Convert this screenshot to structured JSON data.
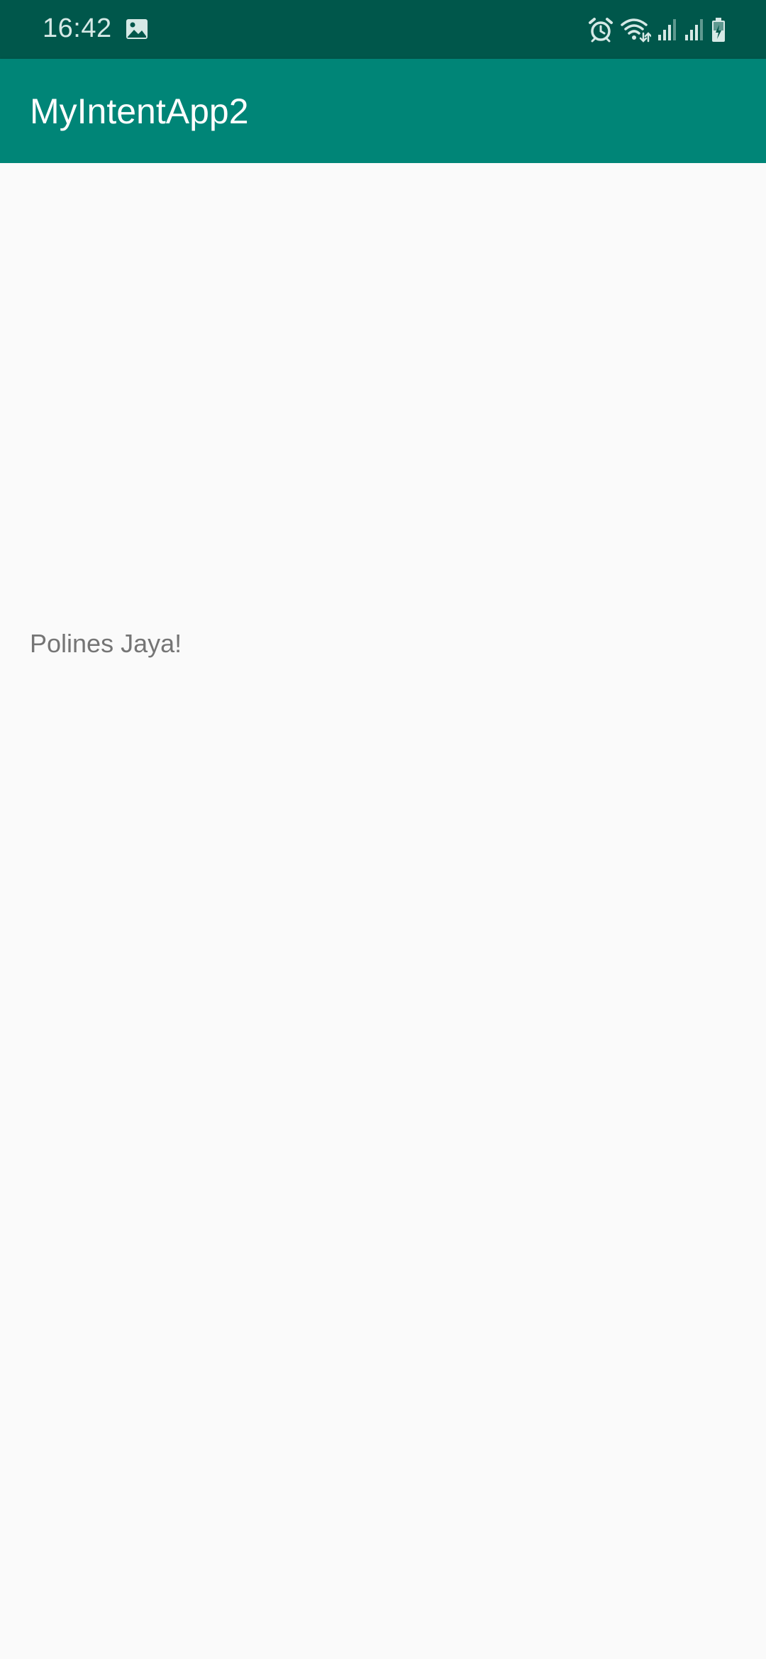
{
  "status_bar": {
    "time": "16:42",
    "left_icons": [
      "image-icon"
    ],
    "right_icons": [
      "alarm-icon",
      "wifi-icon",
      "signal-icon",
      "signal-icon",
      "battery-charging-icon"
    ],
    "background_color": "#00574b"
  },
  "app_bar": {
    "title": "MyIntentApp2",
    "background_color": "#008577"
  },
  "main": {
    "text": "Polines Jaya!"
  }
}
